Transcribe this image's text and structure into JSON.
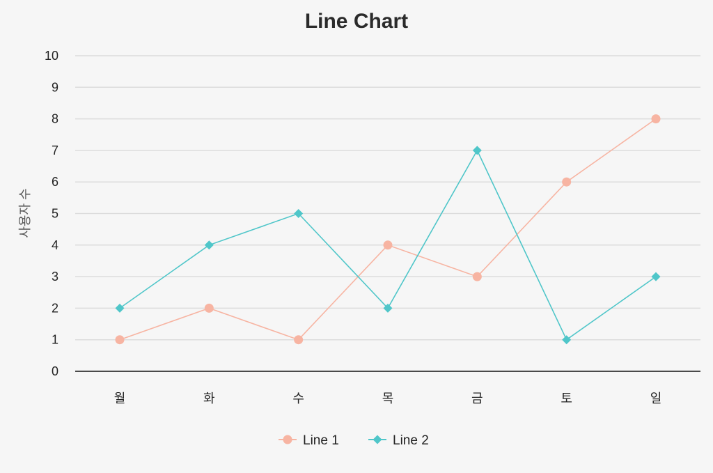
{
  "chart_data": {
    "type": "line",
    "title": "Line Chart",
    "xlabel": "",
    "ylabel": "사용자 수",
    "categories": [
      "월",
      "화",
      "수",
      "목",
      "금",
      "토",
      "일"
    ],
    "ylim": [
      0,
      10
    ],
    "yticks": [
      0,
      1,
      2,
      3,
      4,
      5,
      6,
      7,
      8,
      9,
      10
    ],
    "grid": true,
    "legend_position": "bottom-center",
    "series": [
      {
        "name": "Line 1",
        "values": [
          1,
          2,
          1,
          4,
          3,
          6,
          8
        ],
        "color": "#f7b4a2",
        "marker": "circle"
      },
      {
        "name": "Line 2",
        "values": [
          2,
          4,
          5,
          2,
          7,
          1,
          3
        ],
        "color": "#4fc6c9",
        "marker": "diamond"
      }
    ]
  }
}
